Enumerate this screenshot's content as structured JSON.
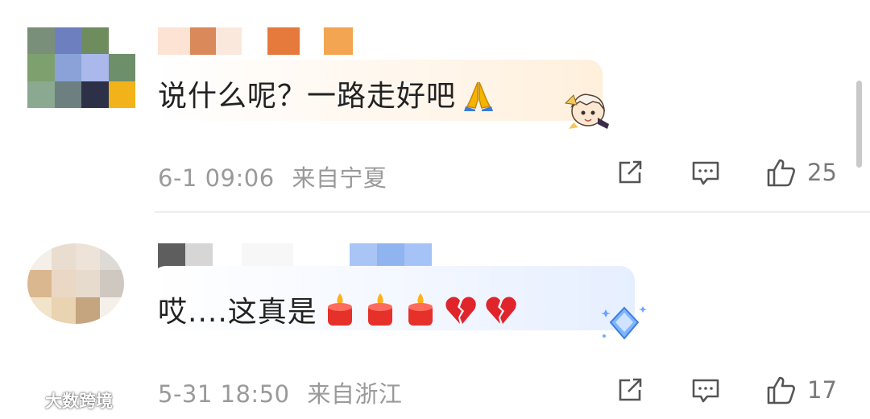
{
  "comments": [
    {
      "text": "说什么呢？一路走好吧",
      "emoji": [
        "folded-hands-emoji"
      ],
      "sticker": "anime-girl-sticker",
      "time": "6-1 09:06",
      "location": "来自宁夏",
      "likes": "25",
      "accent": "#fff0dc"
    },
    {
      "text": "哎....这真是",
      "emoji": [
        "candle-emoji",
        "candle-emoji",
        "candle-emoji",
        "broken-heart-emoji",
        "broken-heart-emoji"
      ],
      "sticker": "diamond-gem-sticker",
      "time": "5-31 18:50",
      "location": "来自浙江",
      "likes": "17",
      "accent": "#e6efff"
    }
  ],
  "watermark": {
    "text": "大数跨境"
  },
  "icons": {
    "share": "share-icon",
    "comment": "comment-icon",
    "like": "thumbs-up-icon"
  }
}
